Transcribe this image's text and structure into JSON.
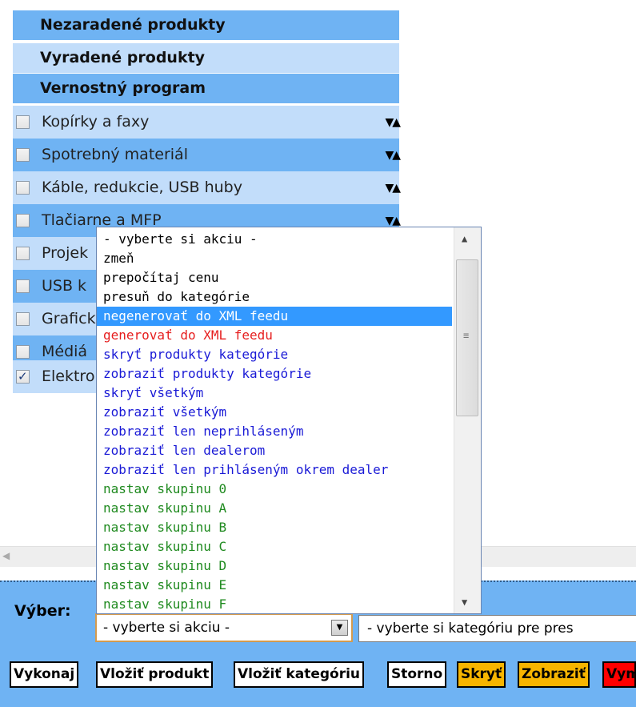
{
  "headers": [
    {
      "label": "Nezaradené produkty"
    },
    {
      "label": "Vyradené produkty"
    },
    {
      "label": "Vernostný program"
    }
  ],
  "categories": [
    {
      "label": "Kopírky a faxy",
      "checked": false,
      "sort": "▼▲"
    },
    {
      "label": "Spotrebný materiál",
      "checked": false,
      "sort": "▼▲"
    },
    {
      "label": "Káble, redukcie, USB huby",
      "checked": false,
      "sort": "▼▲"
    },
    {
      "label": "Tlačiarne a MFP",
      "checked": false,
      "sort": "▼▲"
    },
    {
      "label": "Projek",
      "checked": false
    },
    {
      "label": "USB k",
      "checked": false
    },
    {
      "label": "Grafick",
      "checked": false
    },
    {
      "label": "Médiá",
      "checked": false
    },
    {
      "label": "Elektro",
      "checked": true,
      "check_glyph": "✓"
    }
  ],
  "dropdown": {
    "options": [
      {
        "label": "- vyberte si akciu -",
        "color": "#000000"
      },
      {
        "label": "zmeň",
        "color": "#000000"
      },
      {
        "label": "prepočítaj cenu",
        "color": "#000000"
      },
      {
        "label": "presuň do kategórie",
        "color": "#000000"
      },
      {
        "label": "negenerovať do XML feedu",
        "color": "#ffffff",
        "selected": true
      },
      {
        "label": "generovať do XML feedu",
        "color": "#e61e1e"
      },
      {
        "label": "skryť produkty kategórie",
        "color": "#1a1ad6"
      },
      {
        "label": "zobraziť produkty kategórie",
        "color": "#1a1ad6"
      },
      {
        "label": "skryť všetkým",
        "color": "#1a1ad6"
      },
      {
        "label": "zobraziť všetkým",
        "color": "#1a1ad6"
      },
      {
        "label": "zobraziť len neprihláseným",
        "color": "#1a1ad6"
      },
      {
        "label": "zobraziť len dealerom",
        "color": "#1a1ad6"
      },
      {
        "label": "zobraziť len prihláseným okrem dealer",
        "color": "#1a1ad6"
      },
      {
        "label": "nastav skupinu 0",
        "color": "#1f8a1f"
      },
      {
        "label": "nastav skupinu A",
        "color": "#1f8a1f"
      },
      {
        "label": "nastav skupinu B",
        "color": "#1f8a1f"
      },
      {
        "label": "nastav skupinu C",
        "color": "#1f8a1f"
      },
      {
        "label": "nastav skupinu D",
        "color": "#1f8a1f"
      },
      {
        "label": "nastav skupinu E",
        "color": "#1f8a1f"
      },
      {
        "label": "nastav skupinu F",
        "color": "#1f8a1f"
      }
    ]
  },
  "scrollbar": {
    "up": "▲",
    "down": "▼",
    "grip": "≡",
    "left": "◀"
  },
  "bottom": {
    "vyber_label": "Výber:",
    "action_select_value": "- vyberte si akciu -",
    "drop_arrow": "▼",
    "category_select_value": "- vyberte si kategóriu pre pres"
  },
  "buttons": [
    {
      "label": "Vykonaj",
      "bg": "#ffffff"
    },
    {
      "label": "Vložiť produkt",
      "bg": "#ffffff"
    },
    {
      "label": "Vložiť kategóriu",
      "bg": "#ffffff"
    },
    {
      "label": "Storno",
      "bg": "#ffffff"
    },
    {
      "label": "Skryť",
      "bg": "#f7b500"
    },
    {
      "label": "Zobraziť",
      "bg": "#f7b500"
    },
    {
      "label": "Vym",
      "bg": "#ff0000"
    }
  ]
}
